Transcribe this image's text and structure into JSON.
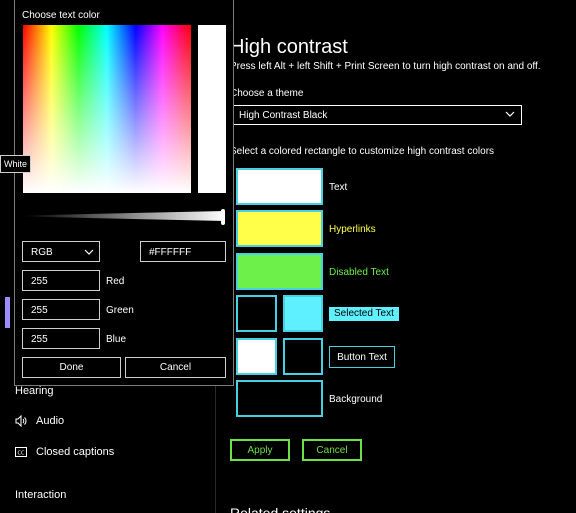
{
  "sidebar": {
    "section_hearing": "Hearing",
    "audio": {
      "label": "Audio",
      "icon": "speaker-icon"
    },
    "closed_captions": {
      "label": "Closed captions",
      "icon": "cc-icon"
    },
    "section_interaction": "Interaction",
    "accent_color": "#9b8cff"
  },
  "main": {
    "title": "High contrast",
    "subtitle": "Press left Alt + left Shift + Print Screen to turn high contrast on and off.",
    "theme_label": "Choose a theme",
    "theme_value": "High Contrast Black",
    "rect_instructions": "Select a colored rectangle to customize high contrast colors",
    "rows": {
      "text": {
        "label": "Text",
        "color": "#ffffff"
      },
      "hyperlinks": {
        "label": "Hyperlinks",
        "color": "#ffff4a"
      },
      "disabled_text": {
        "label": "Disabled Text",
        "color": "#6ef04a"
      },
      "selected_text": {
        "label": "Selected Text",
        "bg": "#5ff0ff",
        "fg": "#000000"
      },
      "button_text": {
        "label": "Button Text",
        "fg": "#ffffff"
      },
      "background": {
        "label": "Background",
        "color": "#000000"
      }
    },
    "apply_label": "Apply",
    "cancel_label": "Cancel",
    "related_settings": "Related settings"
  },
  "picker": {
    "title": "Choose text color",
    "mode": "RGB",
    "hex": "#FFFFFF",
    "red_value": "255",
    "red_label": "Red",
    "green_value": "255",
    "green_label": "Green",
    "blue_value": "255",
    "blue_label": "Blue",
    "done_label": "Done",
    "cancel_label": "Cancel",
    "tooltip": "White",
    "selected_color": "#ffffff"
  }
}
